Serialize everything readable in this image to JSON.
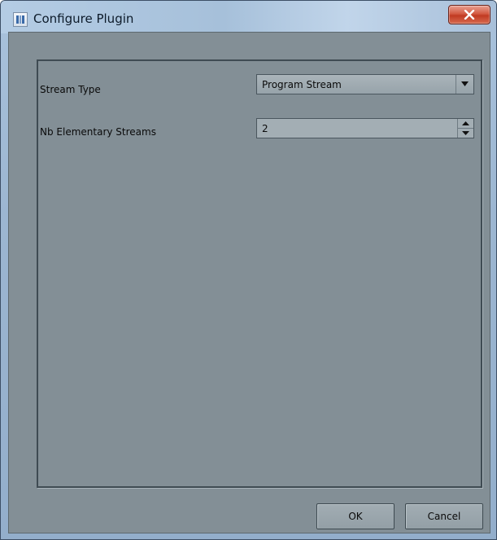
{
  "window": {
    "title": "Configure Plugin"
  },
  "form": {
    "stream_type_label": "Stream Type",
    "stream_type_value": "Program Stream",
    "nb_streams_label": "Nb Elementary Streams",
    "nb_streams_value": "2"
  },
  "buttons": {
    "ok_label": "OK",
    "cancel_label": "Cancel"
  },
  "icons": {
    "app": "app-icon",
    "close": "close-icon",
    "dropdown": "chevron-down-icon",
    "spin_up": "spin-up-icon",
    "spin_down": "spin-down-icon"
  },
  "colors": {
    "client_background": "#838f96",
    "close_button": "#c94a32",
    "titlebar": "#a6c0da"
  }
}
